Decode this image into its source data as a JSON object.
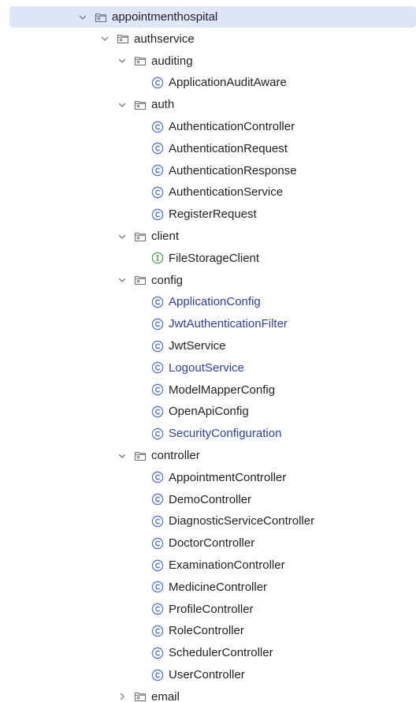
{
  "rows": [
    {
      "type": "package",
      "level": 0,
      "expanded": true,
      "selected": true,
      "label": "appointmenthospital"
    },
    {
      "type": "package",
      "level": 1,
      "expanded": true,
      "label": "authservice"
    },
    {
      "type": "package",
      "level": 2,
      "expanded": true,
      "label": "auditing"
    },
    {
      "type": "class",
      "level": 3,
      "label": "ApplicationAuditAware"
    },
    {
      "type": "package",
      "level": 2,
      "expanded": true,
      "label": "auth"
    },
    {
      "type": "class",
      "level": 3,
      "label": "AuthenticationController"
    },
    {
      "type": "class",
      "level": 3,
      "label": "AuthenticationRequest"
    },
    {
      "type": "class",
      "level": 3,
      "label": "AuthenticationResponse"
    },
    {
      "type": "class",
      "level": 3,
      "label": "AuthenticationService"
    },
    {
      "type": "class",
      "level": 3,
      "label": "RegisterRequest"
    },
    {
      "type": "package",
      "level": 2,
      "expanded": true,
      "label": "client"
    },
    {
      "type": "interface",
      "level": 3,
      "label": "FileStorageClient"
    },
    {
      "type": "package",
      "level": 2,
      "expanded": true,
      "label": "config"
    },
    {
      "type": "class",
      "level": 3,
      "label": "ApplicationConfig",
      "modified": true
    },
    {
      "type": "class",
      "level": 3,
      "label": "JwtAuthenticationFilter",
      "modified": true
    },
    {
      "type": "class",
      "level": 3,
      "label": "JwtService"
    },
    {
      "type": "class",
      "level": 3,
      "label": "LogoutService",
      "modified": true
    },
    {
      "type": "class",
      "level": 3,
      "label": "ModelMapperConfig"
    },
    {
      "type": "class",
      "level": 3,
      "label": "OpenApiConfig"
    },
    {
      "type": "class",
      "level": 3,
      "label": "SecurityConfiguration",
      "modified": true
    },
    {
      "type": "package",
      "level": 2,
      "expanded": true,
      "label": "controller"
    },
    {
      "type": "class",
      "level": 3,
      "label": "AppointmentController"
    },
    {
      "type": "class",
      "level": 3,
      "label": "DemoController"
    },
    {
      "type": "class",
      "level": 3,
      "label": "DiagnosticServiceController"
    },
    {
      "type": "class",
      "level": 3,
      "label": "DoctorController"
    },
    {
      "type": "class",
      "level": 3,
      "label": "ExaminationController"
    },
    {
      "type": "class",
      "level": 3,
      "label": "MedicineController"
    },
    {
      "type": "class",
      "level": 3,
      "label": "ProfileController"
    },
    {
      "type": "class",
      "level": 3,
      "label": "RoleController"
    },
    {
      "type": "class",
      "level": 3,
      "label": "SchedulerController"
    },
    {
      "type": "class",
      "level": 3,
      "label": "UserController"
    },
    {
      "type": "package",
      "level": 2,
      "expanded": false,
      "label": "email"
    }
  ],
  "icons": {
    "package": "package-folder-icon",
    "class": "class-icon",
    "interface": "interface-icon",
    "expanded": "chevron-down-icon",
    "collapsed": "chevron-right-icon"
  },
  "colors": {
    "selection": "#dfe6f7",
    "text": "#1f2023",
    "modified": "#2d3fa8",
    "class_icon": "#4b6fd6",
    "interface_icon": "#4f9b5b",
    "folder_icon": "#6d6f76"
  }
}
